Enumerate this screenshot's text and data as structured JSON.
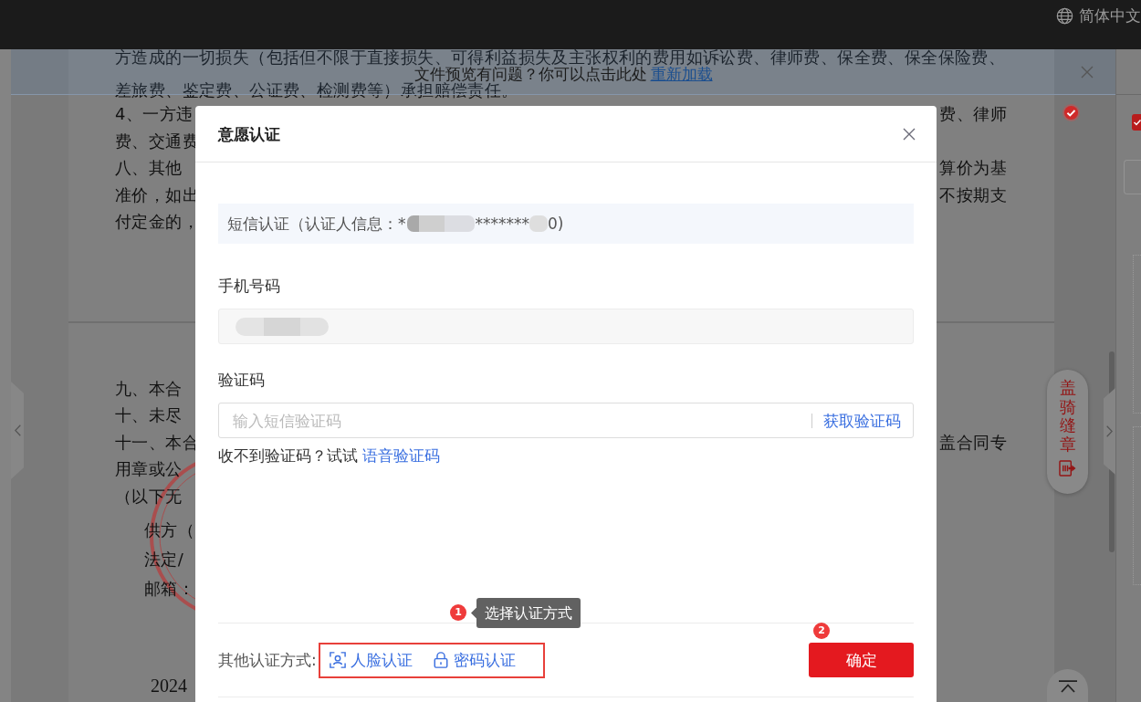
{
  "top_bar": {
    "language": "简体中文"
  },
  "notice_bar": {
    "text": "文件预览有问题？你可以点击此处",
    "link": "重新加载"
  },
  "document": {
    "page_1_lines": [
      {
        "left": "方造成的一切损失（包括但不限于直接损失、可得利益损失及主张权利的费用如诉讼费、律师费、保全费、保全保险费、"
      },
      {
        "left": "差旅费、鉴定费、公证费、检测费等）承担赔偿责任。"
      },
      {
        "left": "4、一方违",
        "right": "费、律师"
      },
      {
        "left": "费、交通费"
      },
      {
        "left": "八、其他",
        "right": "算价为基"
      },
      {
        "left": "准价，如出",
        "right": "不按期支"
      },
      {
        "left": "付定金的，"
      }
    ],
    "page_2_lines": [
      {
        "left": "九、本合"
      },
      {
        "left": "十、未尽"
      },
      {
        "left": "十一、本合",
        "right": "盖合同专"
      },
      {
        "left": "用章或公"
      },
      {
        "left": "（以下无"
      }
    ],
    "signature_lines": [
      "供方（",
      "法定/",
      "邮箱："
    ],
    "date": "2024"
  },
  "side_tools": {
    "seal_button": "盖骑缝章"
  },
  "right_panel": {
    "checkbox_checked": true
  },
  "dialog": {
    "title": "意愿认证",
    "sms_info": {
      "prefix": "短信认证（认证人信息：*",
      "middle": "*******",
      "suffix": "0)"
    },
    "phone": {
      "label": "手机号码"
    },
    "code": {
      "label": "验证码",
      "placeholder": "输入短信验证码",
      "action": "获取验证码"
    },
    "help": {
      "text": "收不到验证码？试试",
      "link": "语音验证码"
    },
    "other_methods": {
      "label": "其他认证方式:",
      "methods": [
        {
          "kind": "face",
          "label": "人脸认证"
        },
        {
          "kind": "password",
          "label": "密码认证"
        }
      ]
    },
    "confirm_button": "确定"
  },
  "annotations": [
    {
      "number": "1",
      "text": "选择认证方式"
    },
    {
      "number": "2"
    }
  ]
}
